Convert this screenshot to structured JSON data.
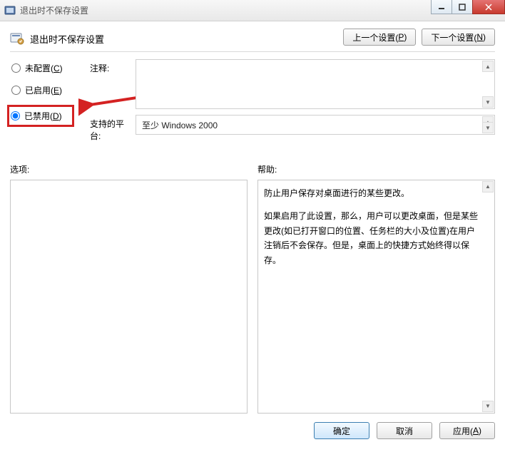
{
  "window": {
    "title": "退出时不保存设置"
  },
  "header": {
    "title": "退出时不保存设置",
    "prev_btn_prefix": "上一个设置(",
    "prev_btn_key": "P",
    "prev_btn_suffix": ")",
    "next_btn_prefix": "下一个设置(",
    "next_btn_key": "N",
    "next_btn_suffix": ")"
  },
  "radios": {
    "not_configured_prefix": "未配置(",
    "not_configured_key": "C",
    "not_configured_suffix": ")",
    "enabled_prefix": "已启用(",
    "enabled_key": "E",
    "enabled_suffix": ")",
    "disabled_prefix": "已禁用(",
    "disabled_key": "D",
    "disabled_suffix": ")"
  },
  "labels": {
    "comment": "注释:",
    "platform": "支持的平台:",
    "options": "选项:",
    "help": "帮助:"
  },
  "platform_value": "至少 Windows 2000",
  "help": {
    "p1": "防止用户保存对桌面进行的某些更改。",
    "p2": "如果启用了此设置，那么，用户可以更改桌面，但是某些更改(如已打开窗口的位置、任务栏的大小及位置)在用户注销后不会保存。但是，桌面上的快捷方式始终得以保存。"
  },
  "footer": {
    "ok": "确定",
    "cancel": "取消",
    "apply_prefix": "应用(",
    "apply_key": "A",
    "apply_suffix": ")"
  }
}
